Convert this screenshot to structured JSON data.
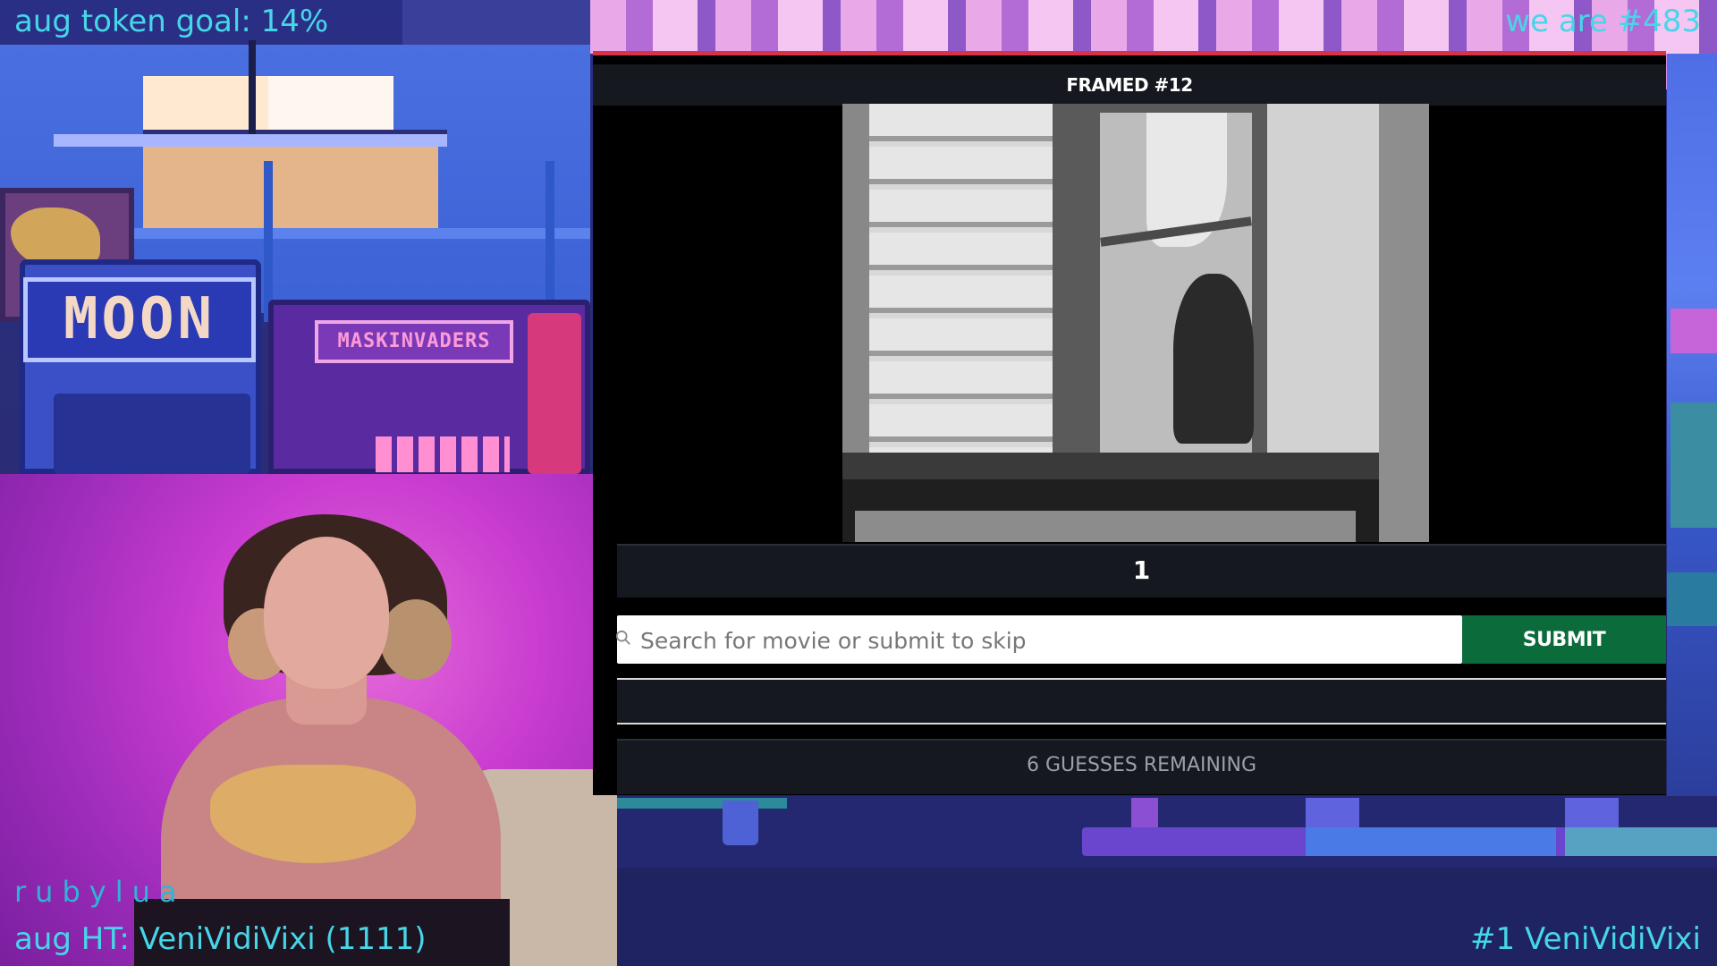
{
  "overlay": {
    "token_goal": "aug token goal: 14%",
    "rank": "we are #483",
    "streamer_name": "rubylua",
    "high_tipper": "aug HT: VeniVidiVixi (1111)",
    "top_user": "#1  VeniVidiVixi"
  },
  "background": {
    "arcade1_sign": "MOON",
    "arcade2_sign": "MASKINVADERS"
  },
  "game": {
    "title": "FRAMED #12",
    "frame_number": "1",
    "search_placeholder": "Search for movie or submit to skip",
    "submit_label": "SUBMIT",
    "guesses_remaining": "6 GUESSES REMAINING"
  },
  "colors": {
    "overlay_text": "#47d6e8",
    "submit_button": "#0b6b3b",
    "panel_accent": "#d63346",
    "panel_dark": "#15191f"
  },
  "icons": {
    "search": "search-icon"
  }
}
